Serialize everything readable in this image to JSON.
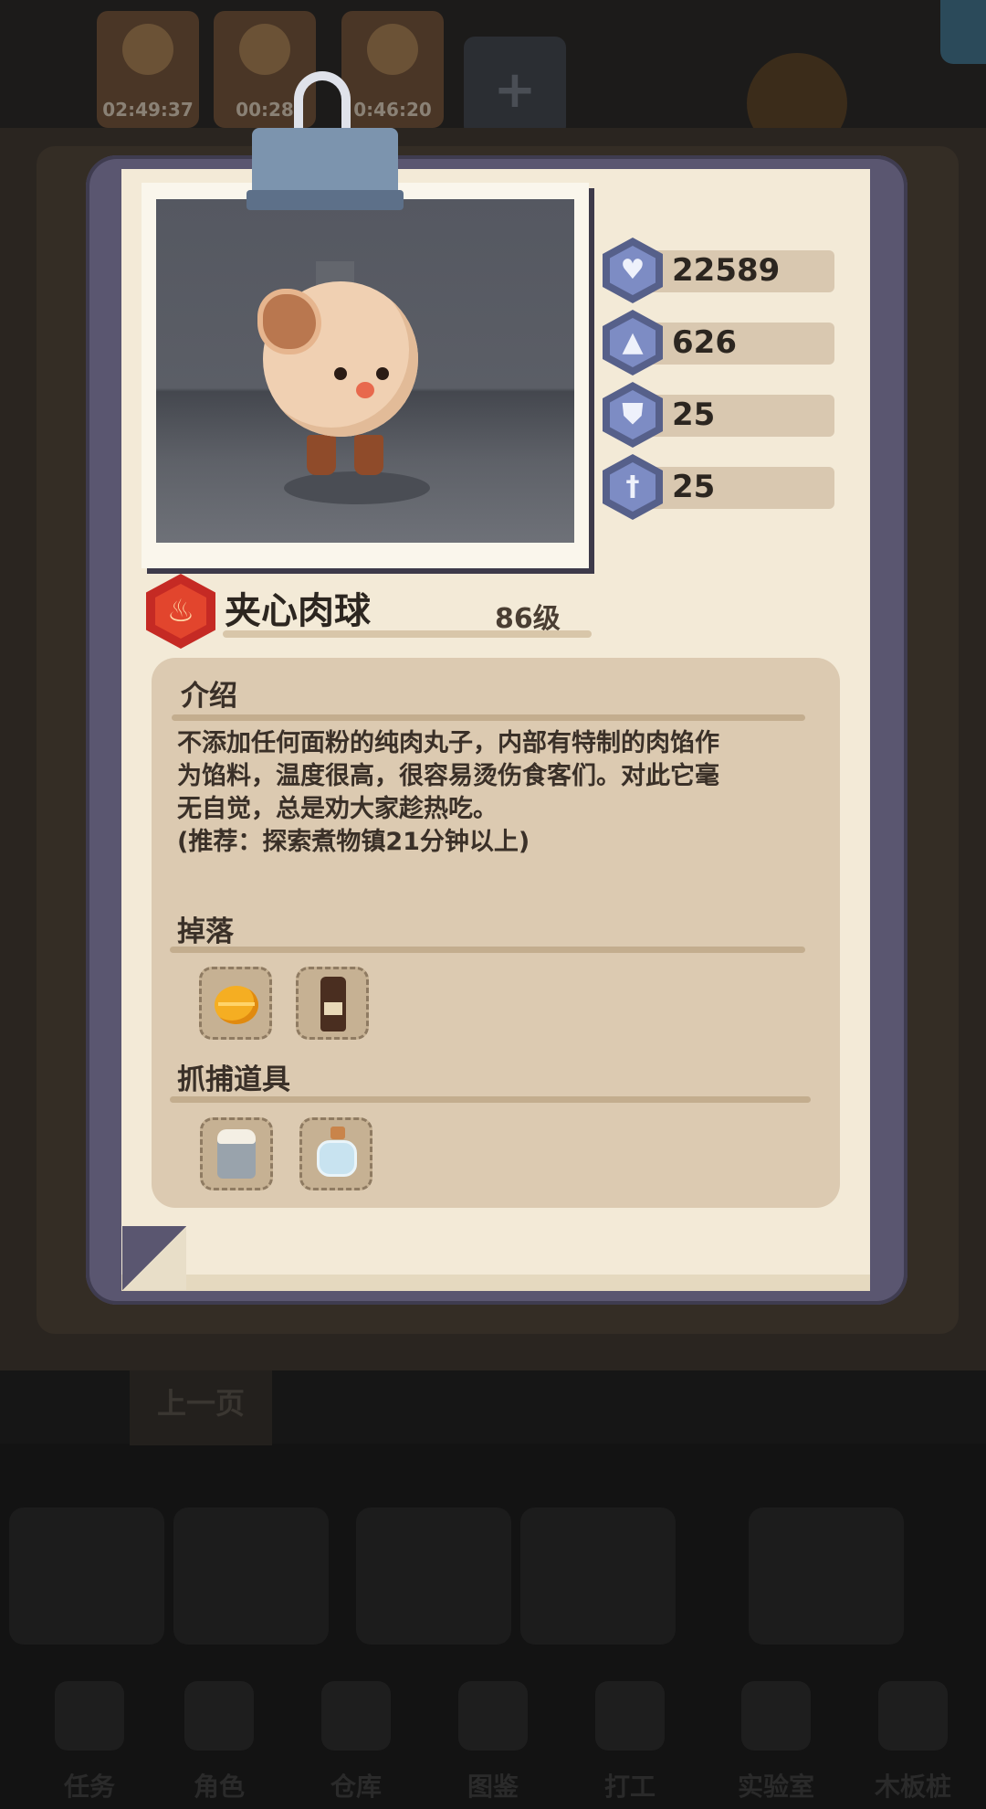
{
  "background": {
    "timers": [
      "02:49:37",
      "00:28",
      "0:46:20"
    ],
    "prev_page_label": "上一页",
    "nav_labels": [
      "任务",
      "角色",
      "仓库",
      "图鉴",
      "打工",
      "实验室",
      "木板桩"
    ]
  },
  "card": {
    "stats": [
      {
        "icon": "heart-icon",
        "value": "22589"
      },
      {
        "icon": "sword-icon",
        "value": "626"
      },
      {
        "icon": "shield-icon",
        "value": "25"
      },
      {
        "icon": "pierce-icon",
        "value": "25"
      }
    ],
    "element_icon": "fire-icon",
    "name": "夹心肉球",
    "level": "86级",
    "intro": {
      "title": "介绍",
      "lines": [
        "不添加任何面粉的纯肉丸子，内部有特制的肉馅作",
        "为馅料，温度很高，很容易烫伤食客们。对此它毫",
        "无自觉，总是劝大家趁热吃。",
        "(推荐：探索煮物镇21分钟以上)"
      ]
    },
    "drops": {
      "title": "掉落",
      "items": [
        "gold-coin-icon",
        "soy-sauce-bottle-icon"
      ]
    },
    "capture_tools": {
      "title": "抓捕道具",
      "items": [
        "salt-jar-icon",
        "glass-vial-icon"
      ]
    }
  },
  "colors": {
    "board": "#5a5670",
    "paper": "#f3ead7",
    "panel": "#dccab1",
    "stat_hex": "#7d8cc4",
    "element_red": "#c52a24"
  }
}
